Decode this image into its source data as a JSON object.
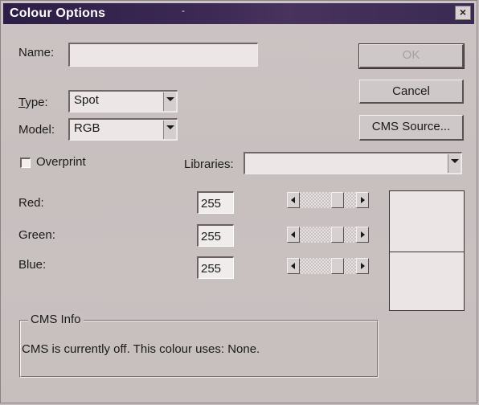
{
  "window": {
    "title": "Colour Options",
    "title_dash": "-",
    "close_label": "×"
  },
  "form": {
    "name_label": "Name:",
    "name_value": "",
    "type_label": "Type:",
    "type_value": "Spot",
    "model_label": "Model:",
    "model_value": "RGB",
    "overprint_label": "Overprint",
    "overprint_checked": false,
    "libraries_label": "Libraries:",
    "libraries_value": ""
  },
  "buttons": {
    "ok": "OK",
    "cancel": "Cancel",
    "cms_source": "CMS Source..."
  },
  "channels": [
    {
      "label": "Red:",
      "value": "255"
    },
    {
      "label": "Green:",
      "value": "255"
    },
    {
      "label": "Blue:",
      "value": "255"
    }
  ],
  "cms_info": {
    "title": "CMS Info",
    "text": "CMS is currently off. This colour uses: None."
  },
  "colors": {
    "titlebar": "#2c1e46",
    "preview": "#ebe6e5"
  }
}
